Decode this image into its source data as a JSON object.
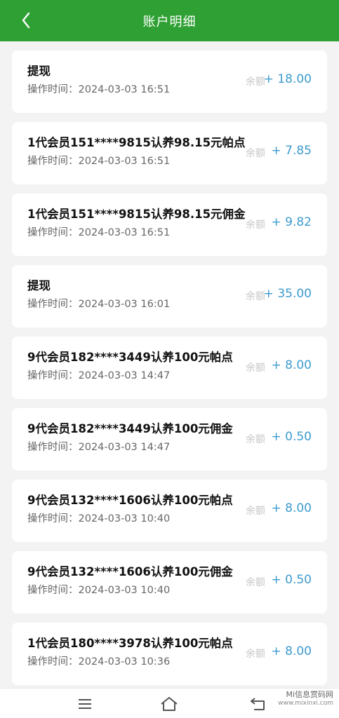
{
  "header": {
    "title": "账户明细",
    "back_icon": "chevron-left-icon"
  },
  "labels": {
    "balance": "余额",
    "time_prefix": "操作时间："
  },
  "records": [
    {
      "title": "提现",
      "time": "2024-03-03 16:51",
      "amount": "+ 18.00"
    },
    {
      "title": "1代会员151****9815认养98.15元帕点",
      "time": "2024-03-03 16:51",
      "amount": "+ 7.85"
    },
    {
      "title": "1代会员151****9815认养98.15元佣金",
      "time": "2024-03-03 16:51",
      "amount": "+ 9.82"
    },
    {
      "title": "提现",
      "time": "2024-03-03 16:01",
      "amount": "+ 35.00"
    },
    {
      "title": "9代会员182****3449认养100元帕点",
      "time": "2024-03-03 14:47",
      "amount": "+ 8.00"
    },
    {
      "title": "9代会员182****3449认养100元佣金",
      "time": "2024-03-03 14:47",
      "amount": "+ 0.50"
    },
    {
      "title": "9代会员132****1606认养100元帕点",
      "time": "2024-03-03 10:40",
      "amount": "+ 8.00"
    },
    {
      "title": "9代会员132****1606认养100元佣金",
      "time": "2024-03-03 10:40",
      "amount": "+ 0.50"
    },
    {
      "title": "1代会员180****3978认养100元帕点",
      "time": "2024-03-03 10:36",
      "amount": "+ 8.00"
    }
  ],
  "navbar": {
    "menu_icon": "menu-icon",
    "home_icon": "home-icon",
    "back_icon": "back-arrow-icon"
  },
  "watermark": {
    "line1": "Mi信息赏码网",
    "line2": "www.mixinxi.com"
  },
  "colors": {
    "header_bg": "#2fa134",
    "amount": "#3d9bcf",
    "balance_label": "#c7c7c7",
    "page_bg": "#f3f3f3"
  }
}
